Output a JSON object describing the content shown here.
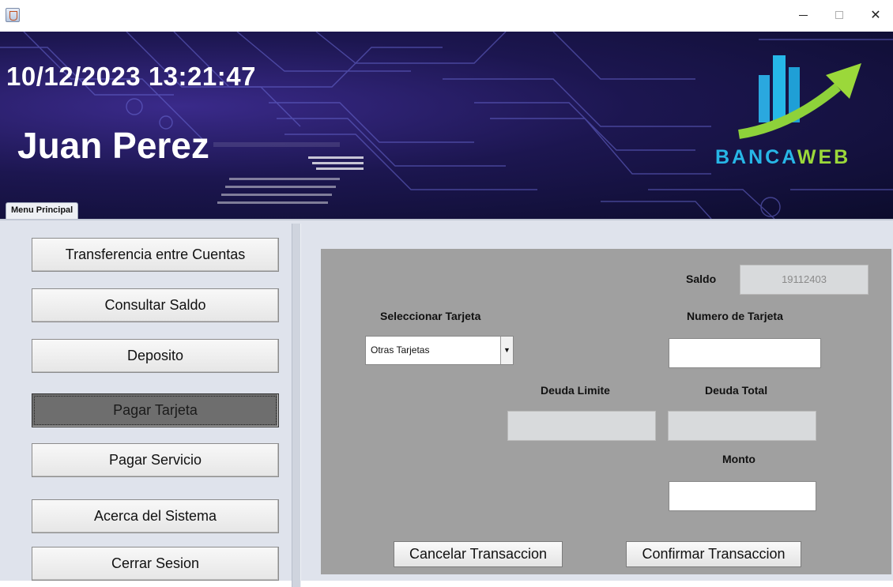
{
  "window": {
    "minimize_symbol": "",
    "close_symbol": "✕"
  },
  "banner": {
    "datetime": "10/12/2023 13:21:47",
    "username": "Juan Perez",
    "logo_text_a": "BANCA",
    "logo_text_b": "WEB",
    "tab_label": "Menu Principal"
  },
  "menu": {
    "items": [
      {
        "label": "Transferencia entre Cuentas"
      },
      {
        "label": "Consultar Saldo"
      },
      {
        "label": "Deposito"
      },
      {
        "label": "Pagar Tarjeta"
      },
      {
        "label": "Pagar Servicio"
      },
      {
        "label": "Acerca del Sistema"
      },
      {
        "label": "Cerrar Sesion"
      }
    ],
    "active": "Pagar Tarjeta"
  },
  "form": {
    "saldo_label": "Saldo",
    "saldo_value": "19112403",
    "seleccionar_label": "Seleccionar Tarjeta",
    "tarjeta_selected": "Otras Tarjetas",
    "numero_label": "Numero de Tarjeta",
    "numero_value": "",
    "deuda_limite_label": "Deuda Limite",
    "deuda_limite_value": "",
    "deuda_total_label": "Deuda Total",
    "deuda_total_value": "",
    "monto_label": "Monto",
    "monto_value": "",
    "cancel_label": "Cancelar Transaccion",
    "confirm_label": "Confirmar Transaccion"
  },
  "colors": {
    "banner_bg": "#1c1650",
    "logo_blue": "#27b6e6",
    "logo_green": "#9bd83a",
    "panel_bg": "#a0a0a0",
    "active_button": "#6e6e6e"
  }
}
